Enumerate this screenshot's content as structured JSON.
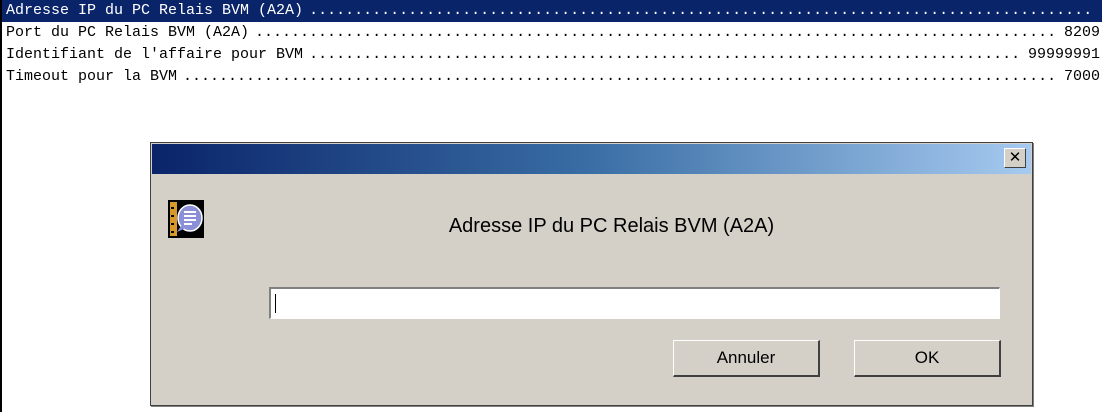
{
  "settings": [
    {
      "label": "Adresse IP du PC Relais BVM (A2A)",
      "value": "",
      "selected": true
    },
    {
      "label": "Port du PC Relais BVM (A2A)",
      "value": "8209",
      "selected": false
    },
    {
      "label": "Identifiant de l'affaire pour BVM",
      "value": "99999991",
      "selected": false
    },
    {
      "label": "Timeout pour la BVM",
      "value": "7000",
      "selected": false
    }
  ],
  "dialog": {
    "title": "",
    "close_label": "✕",
    "message": "Adresse IP du PC Relais BVM (A2A)",
    "input_value": "",
    "cancel_label": "Annuler",
    "ok_label": "OK",
    "icon": "message-icon"
  },
  "colors": {
    "selection": "#0a246a",
    "dialog_bg": "#d4d0c8"
  }
}
